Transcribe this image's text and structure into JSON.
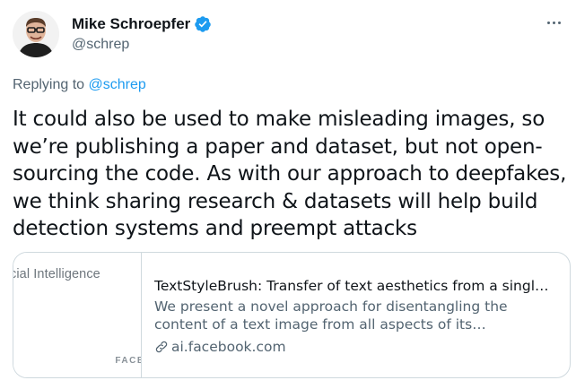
{
  "author": {
    "display_name": "Mike Schroepfer",
    "handle": "@schrep",
    "verified": true
  },
  "reply": {
    "prefix": "Replying to ",
    "mention": "@schrep"
  },
  "tweet": {
    "text": "It could also be used to make misleading images, so\nwe’re publishing a paper and dataset, but not open-\nsourcing the code. As with our approach to deepfakes,\nwe think sharing research & datasets will help build\ndetection systems and preempt attacks"
  },
  "card": {
    "thumb_title": "cial Intelligence",
    "thumb_brand": "FACE",
    "title": "TextStyleBrush: Transfer of text aesthetics from a single example",
    "description": "We present a novel approach for disentangling the content of a text image from all aspects of its appearance …",
    "domain": "ai.facebook.com"
  },
  "colors": {
    "accent": "#1d9bf0",
    "muted": "#536471",
    "text": "#0f1419",
    "border": "#cfd9de"
  },
  "icons": {
    "verified": "verified-badge-icon",
    "more": "more-icon",
    "link": "link-icon"
  }
}
